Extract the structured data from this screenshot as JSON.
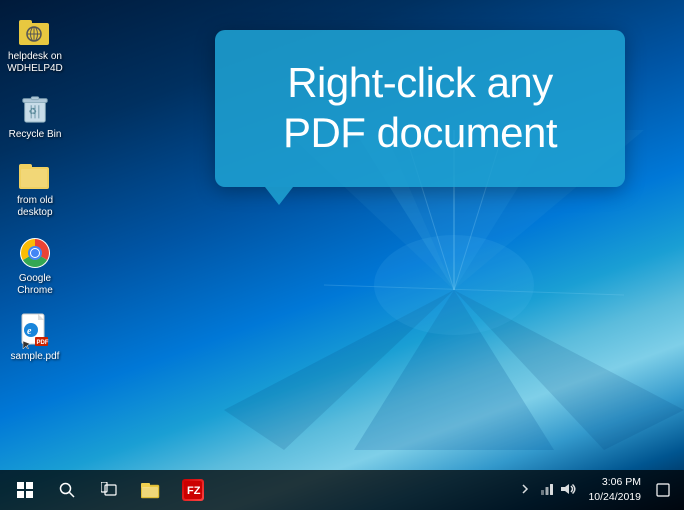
{
  "desktop": {
    "icons": [
      {
        "id": "helpdesk",
        "label": "helpdesk on WDHELP4D",
        "type": "folder"
      },
      {
        "id": "recycle-bin",
        "label": "Recycle Bin",
        "type": "recycle"
      },
      {
        "id": "from-old-desktop",
        "label": "from old desktop",
        "type": "folder"
      },
      {
        "id": "google-chrome",
        "label": "Google Chrome",
        "type": "chrome"
      },
      {
        "id": "sample-pdf",
        "label": "sample.pdf",
        "type": "pdf"
      }
    ]
  },
  "callout": {
    "text": "Right-click any PDF document"
  },
  "taskbar": {
    "start_label": "⊞",
    "search_placeholder": "Search",
    "clock": {
      "time": "3:06 PM",
      "date": "10/24/2019"
    },
    "apps": [
      "windows-explorer",
      "filezilla"
    ],
    "tray": [
      "chevron",
      "network",
      "volume",
      "notification"
    ]
  }
}
